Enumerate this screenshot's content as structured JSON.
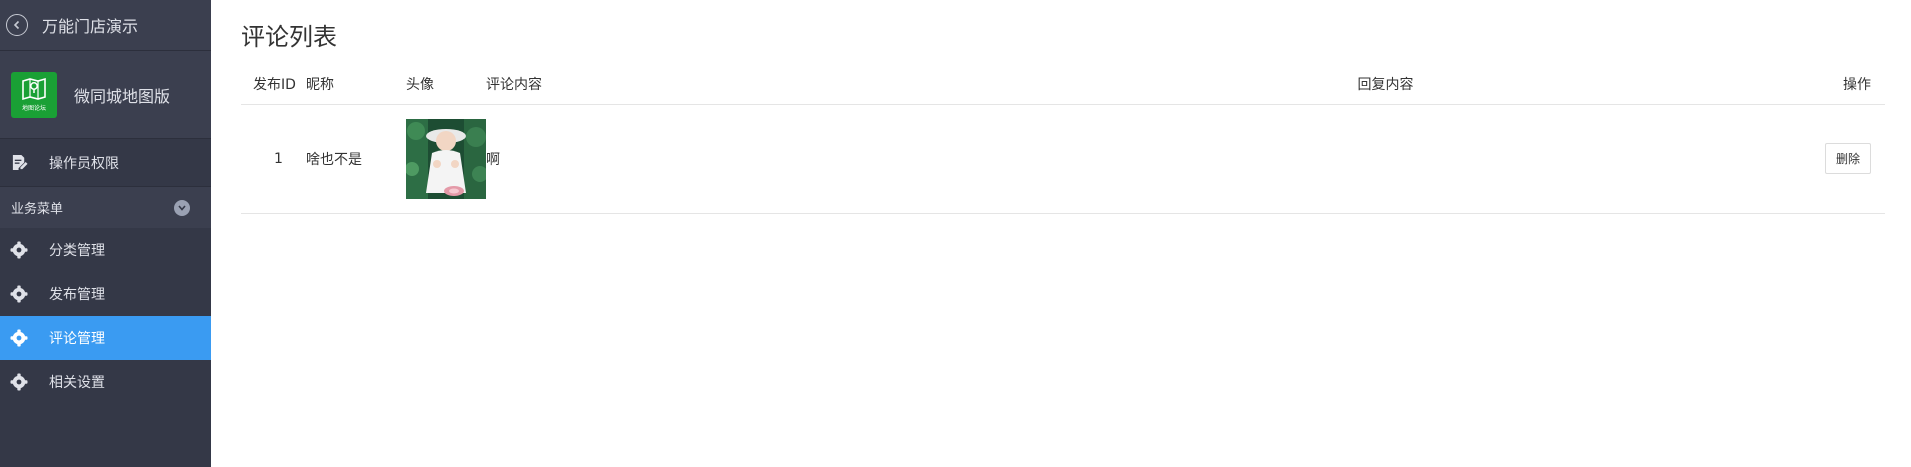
{
  "sidebar": {
    "store_name": "万能门店演示",
    "app_name": "微同城地图版",
    "app_logo_text": "地图论坛",
    "permissions_label": "操作员权限",
    "group_label": "业务菜单",
    "items": [
      {
        "label": "分类管理"
      },
      {
        "label": "发布管理"
      },
      {
        "label": "评论管理"
      },
      {
        "label": "相关设置"
      }
    ]
  },
  "main": {
    "title": "评论列表",
    "columns": {
      "id": "发布ID",
      "nickname": "昵称",
      "avatar": "头像",
      "comment": "评论内容",
      "reply": "回复内容",
      "actions": "操作"
    },
    "rows": [
      {
        "id": "1",
        "nickname": "啥也不是",
        "comment": "啊",
        "reply": "",
        "delete_label": "删除"
      }
    ]
  },
  "colors": {
    "sidebar_bg": "#343847",
    "active_item": "#3a9bf2",
    "logo_green": "#1aa035"
  }
}
